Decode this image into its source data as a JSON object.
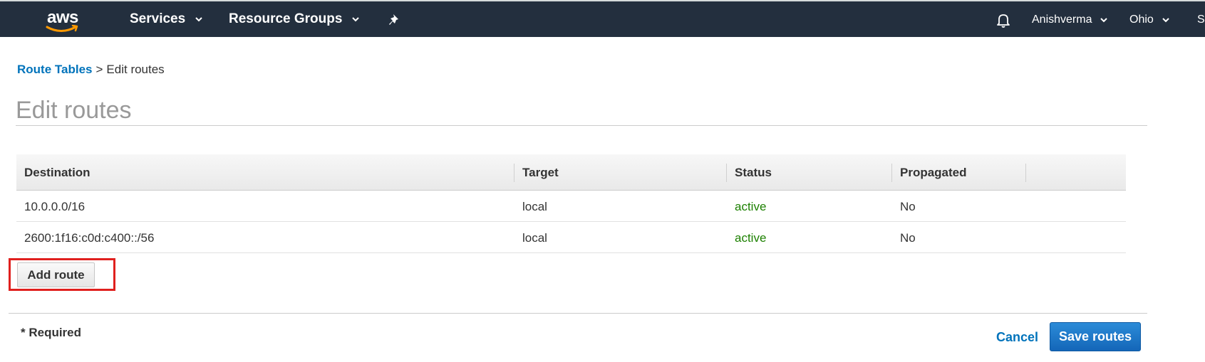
{
  "topnav": {
    "logo_text": "aws",
    "services_label": "Services",
    "resource_groups_label": "Resource Groups",
    "user_label": "Anishverma",
    "region_label": "Ohio",
    "support_label": "S"
  },
  "breadcrumb": {
    "parent": "Route Tables",
    "separator": ">",
    "current": "Edit routes"
  },
  "page": {
    "title": "Edit routes"
  },
  "routes_table": {
    "headers": [
      "Destination",
      "Target",
      "Status",
      "Propagated"
    ],
    "rows": [
      {
        "destination": "10.0.0.0/16",
        "target": "local",
        "status": "active",
        "propagated": "No"
      },
      {
        "destination": "2600:1f16:c0d:c400::/56",
        "target": "local",
        "status": "active",
        "propagated": "No"
      }
    ]
  },
  "actions": {
    "add_route_label": "Add route",
    "required_note": "* Required",
    "cancel_label": "Cancel",
    "save_label": "Save routes"
  },
  "colors": {
    "nav_bg": "#232f3e",
    "link": "#0073bb",
    "status_active": "#1d8102",
    "primary_button": "#1466b8",
    "highlight": "#e0201e"
  },
  "icons": [
    "aws-logo-icon",
    "chevron-down-icon",
    "pin-icon",
    "bell-icon"
  ]
}
